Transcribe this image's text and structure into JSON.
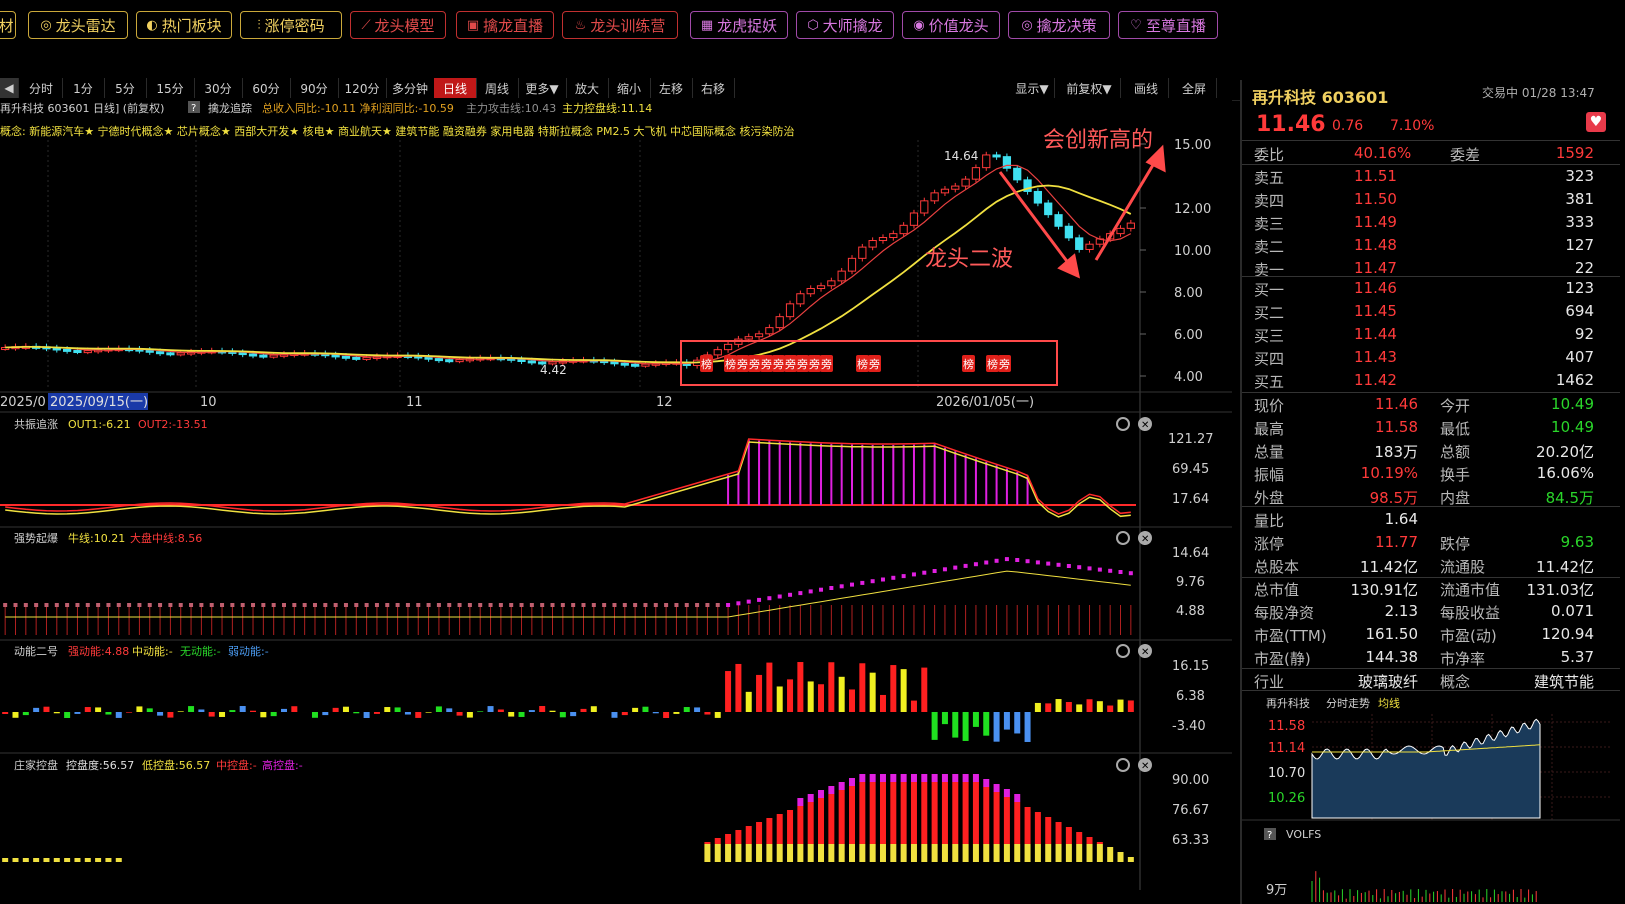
{
  "topbar": {
    "buttons": [
      {
        "label": "材",
        "style": "y",
        "x": -4,
        "w": 20
      },
      {
        "label": "龙头雷达",
        "style": "y",
        "x": 28,
        "w": 100,
        "icon": "◎"
      },
      {
        "label": "热门板块",
        "style": "y",
        "x": 136,
        "w": 96,
        "icon": "◐"
      },
      {
        "label": "涨停密码",
        "style": "y",
        "x": 240,
        "w": 102,
        "icon": "⫶"
      },
      {
        "label": "龙头模型",
        "style": "r",
        "x": 350,
        "w": 96,
        "icon": "⟋"
      },
      {
        "label": "擒龙直播",
        "style": "r",
        "x": 456,
        "w": 98,
        "icon": "▣"
      },
      {
        "label": "龙头训练营",
        "style": "r",
        "x": 562,
        "w": 116,
        "icon": "♨"
      },
      {
        "label": "龙虎捉妖",
        "style": "m",
        "x": 690,
        "w": 98,
        "icon": "▦"
      },
      {
        "label": "大师擒龙",
        "style": "m",
        "x": 796,
        "w": 98,
        "icon": "⬡"
      },
      {
        "label": "价值龙头",
        "style": "m",
        "x": 902,
        "w": 98,
        "icon": "◉"
      },
      {
        "label": "擒龙决策",
        "style": "m",
        "x": 1008,
        "w": 102,
        "icon": "◎"
      },
      {
        "label": "至尊直播",
        "style": "m",
        "x": 1118,
        "w": 100,
        "icon": "♡"
      }
    ]
  },
  "toolbar": {
    "left": [
      "分时",
      "1分",
      "5分",
      "15分",
      "30分",
      "60分",
      "90分",
      "120分",
      "多分钟",
      "日线",
      "周线",
      "更多▼",
      "放大",
      "缩小",
      "左移",
      "右移"
    ],
    "selected": "日线",
    "right": [
      "显示▼",
      "前复权▼",
      "画线",
      "全屏"
    ]
  },
  "main_chart": {
    "header": "再升科技 603601 日线] (前复权)",
    "indicator": "擒龙追踪",
    "indicator_vals": "总收入同比:-10.11 净利润同比:-10.59",
    "attack": "主力攻击线:10.43",
    "control": "主力控盘线:11.14",
    "concepts": "概念: 新能源汽车★ 宁德时代概念★ 芯片概念★ 西部大开发★ 核电★ 商业航天★ 建筑节能 融资融券 家用电器 特斯拉概念 PM2.5 大飞机 中芯国际概念 核污染防治",
    "high_label": "14.64",
    "low_label": "4.42",
    "annot_new_high": "会创新高的",
    "annot_second_wave": "龙头二波",
    "y_ticks": [
      "15.00",
      "12.00",
      "10.00",
      "8.00",
      "6.00",
      "4.00"
    ],
    "x_labels": [
      "2025/0",
      "2025/09/15(一)",
      "10",
      "11",
      "12",
      "2026/01/05(一)"
    ],
    "badges": [
      "榜",
      "榜",
      "旁",
      "旁",
      "旁",
      "旁",
      "旁",
      "旁",
      "旁",
      "旁",
      "榜",
      "旁",
      "榜",
      "榜",
      "旁"
    ]
  },
  "sub1": {
    "title": "共振追涨",
    "out1": "OUT1:-6.21",
    "out2": "OUT2:-13.51",
    "ticks": [
      "121.27",
      "69.45",
      "17.64"
    ]
  },
  "sub2": {
    "title": "强势起爆",
    "bull": "牛线:10.21",
    "mid": "大盘中线:8.56",
    "ticks": [
      "14.64",
      "9.76",
      "4.88"
    ]
  },
  "sub3": {
    "title": "动能二号",
    "strong": "强动能:4.88",
    "medium": "中动能:-",
    "none": "无动能:-",
    "weak": "弱动能:-",
    "ticks": [
      "16.15",
      "6.38",
      "-3.40"
    ]
  },
  "sub4": {
    "title": "庄家控盘",
    "degree": "控盘度:56.57",
    "low": "低控盘:56.57",
    "mid": "中控盘:-",
    "high": "高控盘:-",
    "ticks": [
      "90.00",
      "76.67",
      "63.33"
    ]
  },
  "quote": {
    "name": "再升科技 603601",
    "status": "交易中 01/28 13:47",
    "price": "11.46",
    "change": "0.76",
    "pct": "7.10%",
    "webi": "40.16%",
    "weicha": "1592",
    "asks": [
      [
        "卖五",
        "11.51",
        "323"
      ],
      [
        "卖四",
        "11.50",
        "381"
      ],
      [
        "卖三",
        "11.49",
        "333"
      ],
      [
        "卖二",
        "11.48",
        "127"
      ],
      [
        "卖一",
        "11.47",
        "22"
      ]
    ],
    "bids": [
      [
        "买一",
        "11.46",
        "123"
      ],
      [
        "买二",
        "11.45",
        "694"
      ],
      [
        "买三",
        "11.44",
        "92"
      ],
      [
        "买四",
        "11.43",
        "407"
      ],
      [
        "买五",
        "11.42",
        "1462"
      ]
    ],
    "stats": [
      [
        "现价",
        "11.46",
        "red",
        "今开",
        "10.49",
        "green"
      ],
      [
        "最高",
        "11.58",
        "red",
        "最低",
        "10.49",
        "green"
      ],
      [
        "总量",
        "183万",
        "white",
        "总额",
        "20.20亿",
        "white"
      ],
      [
        "振幅",
        "10.19%",
        "red",
        "换手",
        "16.06%",
        "white"
      ],
      [
        "外盘",
        "98.5万",
        "red",
        "内盘",
        "84.5万",
        "green"
      ],
      [
        "量比",
        "1.64",
        "white",
        "",
        "",
        ""
      ],
      [
        "涨停",
        "11.77",
        "red",
        "跌停",
        "9.63",
        "green"
      ],
      [
        "总股本",
        "11.42亿",
        "white",
        "流通股",
        "11.42亿",
        "white"
      ],
      [
        "总市值",
        "130.91亿",
        "white",
        "流通市值",
        "131.03亿",
        "white"
      ],
      [
        "每股净资",
        "2.13",
        "white",
        "每股收益",
        "0.071",
        "white"
      ],
      [
        "市盈(TTM)",
        "161.50",
        "white",
        "市盈(动)",
        "120.94",
        "white"
      ],
      [
        "市盈(静)",
        "144.38",
        "white",
        "市净率",
        "5.37",
        "white"
      ]
    ],
    "industry_label": "行业",
    "industry": "玻璃玻纤",
    "concept_label": "概念",
    "concept": "建筑节能",
    "mini_title": "再升科技",
    "mini_sub": "分时走势",
    "mini_avg": "均线",
    "mini_ticks": [
      "11.58",
      "11.14",
      "10.70",
      "10.26"
    ],
    "vol_label": "VOLFS",
    "vol_tick": "9万"
  },
  "colors": {
    "up": "#ff3a3a",
    "down": "#2ad62a",
    "cyan": "#40e0f0",
    "yellow": "#f0e040",
    "magenta": "#e020e0"
  }
}
